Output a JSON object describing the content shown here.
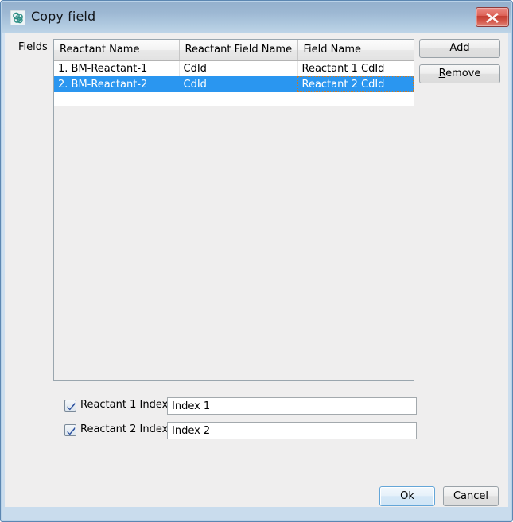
{
  "window": {
    "title": "Copy field",
    "icon": "molecule-icon",
    "close_icon": "close-icon",
    "accent_selection": "#2a96f0",
    "accent_title": "#9db8d3",
    "close_color": "#d55a4c"
  },
  "fields_section": {
    "label": "Fields",
    "table": {
      "columns": [
        "Reactant Name",
        "Reactant Field Name",
        "Field Name"
      ],
      "rows": [
        {
          "cells": [
            "1. BM-Reactant-1",
            "CdId",
            "Reactant 1 CdId"
          ],
          "selected": false
        },
        {
          "cells": [
            "2. BM-Reactant-2",
            "CdId",
            "Reactant 2 CdId"
          ],
          "selected": true
        }
      ]
    },
    "buttons": {
      "add": {
        "prefix": "",
        "mnemonic": "A",
        "suffix": "dd"
      },
      "remove": {
        "prefix": "",
        "mnemonic": "R",
        "suffix": "emove"
      }
    }
  },
  "index_options": [
    {
      "label": "Reactant 1 Index",
      "checked": true,
      "value": "Index 1",
      "placeholder": ""
    },
    {
      "label": "Reactant 2 Index",
      "checked": true,
      "value": "Index 2",
      "placeholder": ""
    }
  ],
  "footer": {
    "ok_label": "Ok",
    "cancel_label": "Cancel"
  }
}
